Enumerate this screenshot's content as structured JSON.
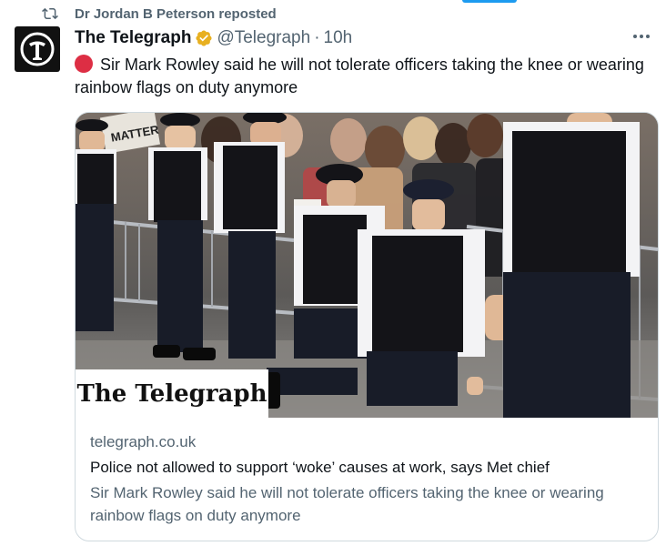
{
  "repost": {
    "label": "Dr Jordan B Peterson reposted",
    "icon": "repost-icon"
  },
  "tweet": {
    "avatar_icon": "telegraph-t-logo",
    "display_name": "The Telegraph",
    "verified_icon": "verified-gold-badge",
    "handle": "@Telegraph",
    "separator": "·",
    "time": "10h",
    "more_icon": "more-horizontal-icon",
    "text": "Sir Mark Rowley said he will not tolerate officers taking the knee or wearing rainbow flags on duty anymore",
    "emoji": "red-circle"
  },
  "card": {
    "logo_text": "The Telegraph",
    "domain": "telegraph.co.uk",
    "title": "Police not allowed to support ‘woke’ causes at work, says Met chief",
    "description": "Sir Mark Rowley said he will not tolerate officers taking the knee or wearing rainbow flags on duty anymore",
    "image_alt": "police-officers-kneeling-photo"
  },
  "colors": {
    "text_primary": "#0f1419",
    "text_secondary": "#536471",
    "border": "#cfd9de",
    "verified": "#e8b020",
    "accent": "#1d9bf0",
    "red_emoji": "#dd2e44"
  }
}
